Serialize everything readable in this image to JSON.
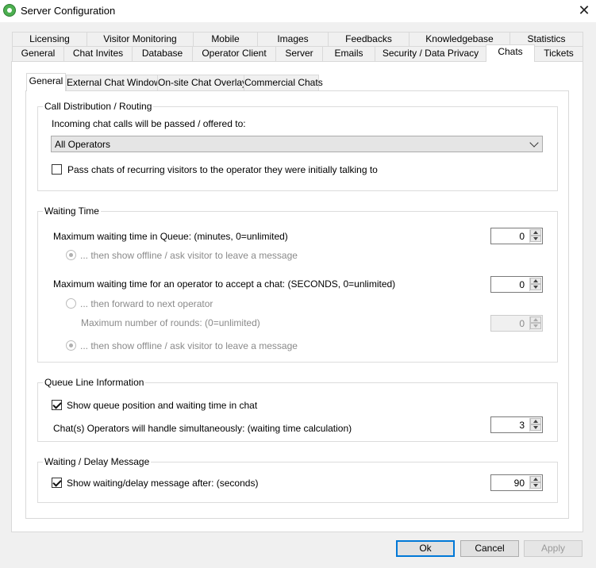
{
  "window": {
    "title": "Server Configuration",
    "close_glyph": "✕"
  },
  "outer_tabs_row1": [
    "Licensing",
    "Visitor Monitoring",
    "Mobile",
    "Images",
    "Feedbacks",
    "Knowledgebase",
    "Statistics"
  ],
  "outer_tabs_row2": [
    "General",
    "Chat Invites",
    "Database",
    "Operator Client",
    "Server",
    "Emails",
    "Security / Data Privacy",
    "Chats",
    "Tickets"
  ],
  "inner_tabs": [
    "General",
    "External Chat Window",
    "On-site Chat Overlay",
    "Commercial Chats"
  ],
  "call_distribution": {
    "title": "Call Distribution / Routing",
    "incoming_label": "Incoming chat calls will be passed / offered to:",
    "selected_option": "All Operators",
    "recurring_label": "Pass chats of recurring visitors to the operator they were initially talking to"
  },
  "waiting_time": {
    "title": "Waiting Time",
    "max_queue_label": "Maximum waiting time in Queue: (minutes, 0=unlimited)",
    "max_queue_value": "0",
    "queue_offline_label": "... then show offline / ask visitor to leave a message",
    "max_accept_label": "Maximum waiting time for an operator to accept a chat: (SECONDS, 0=unlimited)",
    "max_accept_value": "0",
    "forward_label": "... then forward to next operator",
    "rounds_label": "Maximum number of rounds: (0=unlimited)",
    "rounds_value": "0",
    "accept_offline_label": "... then show offline / ask visitor to leave a message"
  },
  "queue_info": {
    "title": "Queue Line Information",
    "show_position_label": "Show queue position and waiting time in chat",
    "simultaneous_label": "Chat(s) Operators will handle simultaneously: (waiting time calculation)",
    "simultaneous_value": "3"
  },
  "delay_message": {
    "title": "Waiting / Delay Message",
    "show_delay_label": "Show waiting/delay message after: (seconds)",
    "delay_value": "90"
  },
  "footer": {
    "ok": "Ok",
    "cancel": "Cancel",
    "apply": "Apply"
  }
}
